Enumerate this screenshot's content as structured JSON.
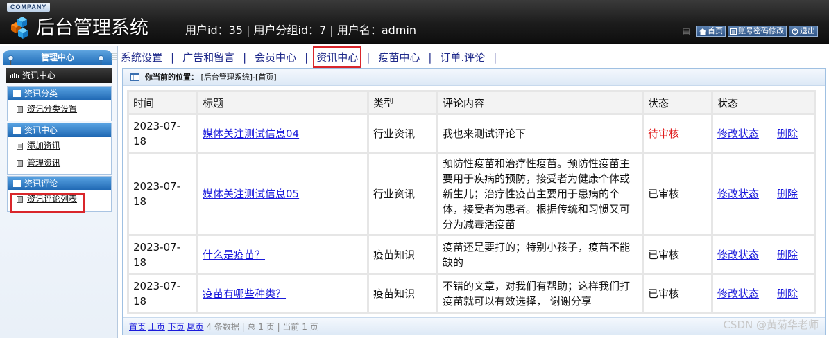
{
  "header": {
    "company": "COMPANY",
    "title": "后台管理系统",
    "user_info": "用户id：35 | 用户分组id：7 | 用户名：admin",
    "links": {
      "home": "首页",
      "password": "账号密码修改",
      "logout": "退出"
    }
  },
  "sidebar": {
    "title": "管理中心",
    "section": "资讯中心",
    "groups": [
      {
        "title": "资讯分类",
        "items": [
          "资讯分类设置"
        ]
      },
      {
        "title": "资讯中心",
        "items": [
          "添加资讯",
          "管理资讯"
        ]
      },
      {
        "title": "资讯评论",
        "items": [
          "资讯评论列表"
        ]
      }
    ]
  },
  "nav": {
    "tabs": [
      "系统设置",
      "广告和留言",
      "会员中心",
      "资讯中心",
      "疫苗中心",
      "订单.评论"
    ],
    "separator": "|"
  },
  "breadcrumb": {
    "label": "你当前的位置：",
    "path": "[后台管理系统]-[首页]"
  },
  "table": {
    "headers": [
      "时间",
      "标题",
      "类型",
      "评论内容",
      "状态",
      "状态"
    ],
    "rows": [
      {
        "time": "2023-07-18",
        "title": "媒体关注测试信息04",
        "type": "行业资讯",
        "content": "我也来测试评论下",
        "status": "待审核",
        "op_edit": "修改状态",
        "op_delete": "删除"
      },
      {
        "time": "2023-07-18",
        "title": "媒体关注测试信息05",
        "type": "行业资讯",
        "content": "预防性疫苗和治疗性疫苗。预防性疫苗主要用于疾病的预防，接受者为健康个体或新生儿；治疗性疫苗主要用于患病的个体，接受者为患者。根据传统和习惯又可分为减毒活疫苗",
        "status": "已审核",
        "op_edit": "修改状态",
        "op_delete": "删除"
      },
      {
        "time": "2023-07-18",
        "title": "什么是疫苗？",
        "type": "疫苗知识",
        "content": "疫苗还是要打的；特别小孩子，疫苗不能缺的",
        "status": "已审核",
        "op_edit": "修改状态",
        "op_delete": "删除"
      },
      {
        "time": "2023-07-18",
        "title": "疫苗有哪些种类？",
        "type": "疫苗知识",
        "content": "不错的文章，对我们有帮助；这样我们打疫苗就可以有效选择， 谢谢分享",
        "status": "已审核",
        "op_edit": "修改状态",
        "op_delete": "删除"
      }
    ]
  },
  "pager": {
    "first": "首页",
    "prev": "上页",
    "next": "下页",
    "last": "尾页",
    "info": "4 条数据 | 总 1 页 | 当前 1 页"
  },
  "watermark": "CSDN @黄菊华老师",
  "colors": {
    "header_bg": "#1c1c1c",
    "accent_blue": "#1f6cb8",
    "pending_red": "#e01818",
    "highlight_box": "#d9262b"
  }
}
